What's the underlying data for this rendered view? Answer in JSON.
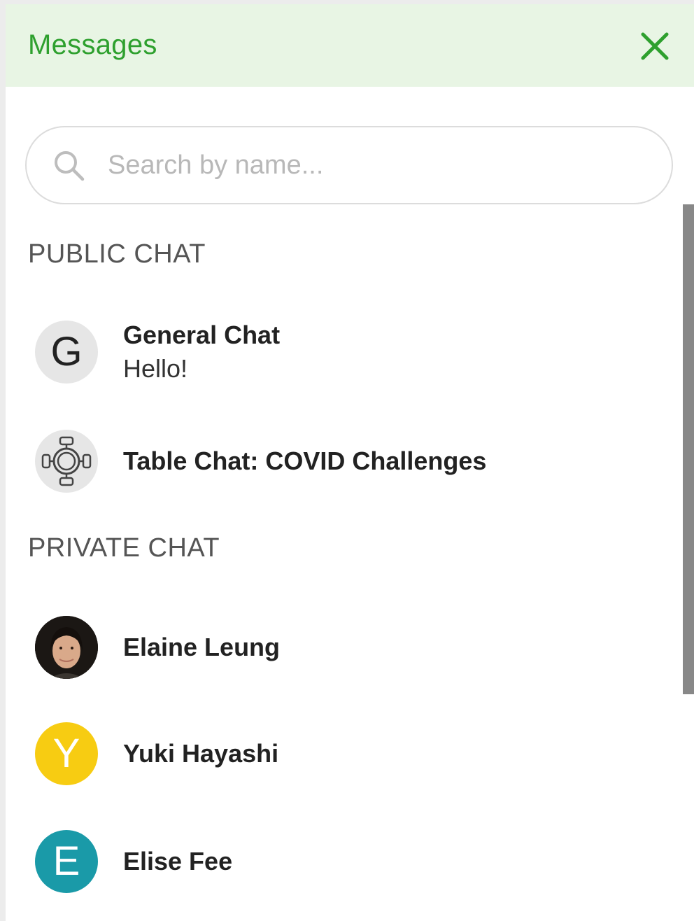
{
  "header": {
    "title": "Messages",
    "close_icon": "close-icon",
    "accent_color": "#2ea02e",
    "background_color": "#e8f5e4"
  },
  "search": {
    "placeholder": "Search by name...",
    "value": "",
    "icon": "search-icon"
  },
  "public_chat": {
    "heading": "PUBLIC CHAT",
    "items": [
      {
        "avatar_letter": "G",
        "name": "General Chat",
        "last_message": "Hello!",
        "avatar_color": "#e6e6e6"
      },
      {
        "avatar_icon": "table-icon",
        "name": "Table Chat: COVID Challenges",
        "avatar_color": "#e6e6e6"
      }
    ]
  },
  "private_chat": {
    "heading": "PRIVATE CHAT",
    "items": [
      {
        "avatar_icon": "user-photo",
        "name": "Elaine Leung"
      },
      {
        "avatar_letter": "Y",
        "name": "Yuki Hayashi",
        "avatar_color": "#f7cc12"
      },
      {
        "avatar_letter": "E",
        "name": "Elise Fee",
        "avatar_color": "#1a9aa8"
      }
    ]
  }
}
